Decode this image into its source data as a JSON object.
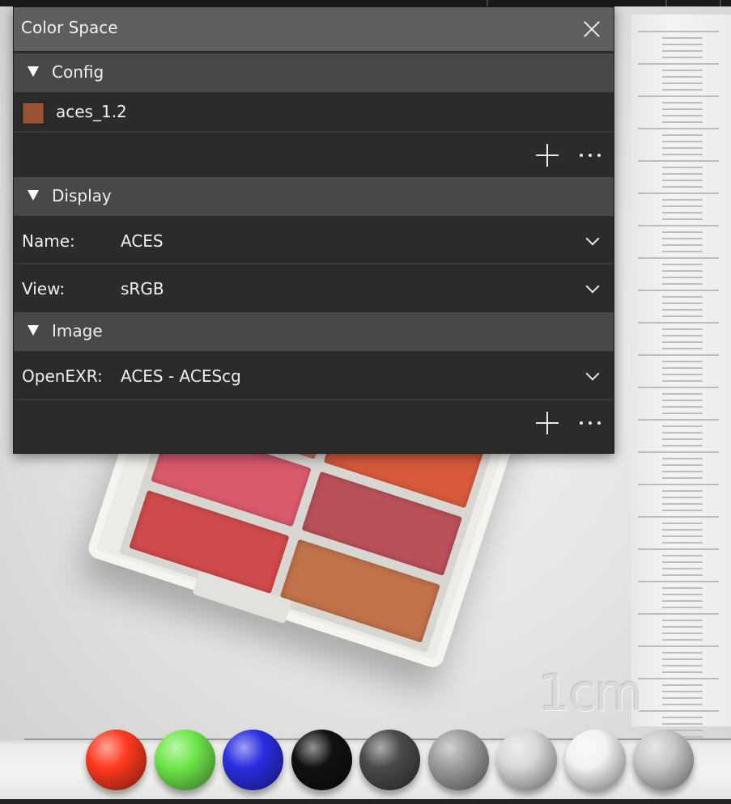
{
  "panel": {
    "title": "Color Space",
    "config": {
      "section_label": "Config",
      "item_label": "aces_1.2",
      "item_swatch_color": "#9a5232"
    },
    "display": {
      "section_label": "Display",
      "name_label": "Name:",
      "name_value": "ACES",
      "view_label": "View:",
      "view_value": "sRGB"
    },
    "image": {
      "section_label": "Image",
      "openexr_label": "OpenEXR:",
      "openexr_value": "ACES - ACEScg"
    }
  },
  "viewport": {
    "ruler_text": "1cm",
    "palette_pan_colors": [
      "#e07a6a",
      "#d85a3c",
      "#d85a6c",
      "#b9505a",
      "#cf4a4a",
      "#c0724a"
    ],
    "sphere_colors": [
      "#ff3a1f",
      "#6ee84a",
      "#2a2ee0",
      "#111111",
      "#4a4a4a",
      "#9c9c9c",
      "#d8d8d8",
      "#f2f2f2",
      "#c8c8c8"
    ]
  }
}
